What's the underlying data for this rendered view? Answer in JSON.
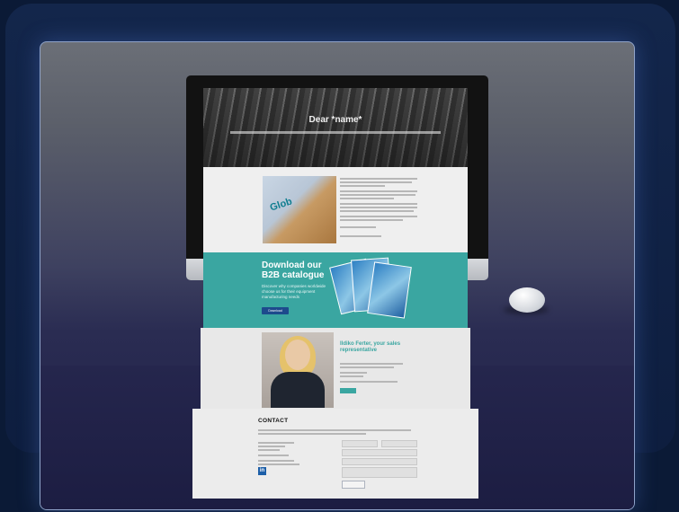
{
  "hero": {
    "title": "Dear *name*"
  },
  "product": {
    "label": "Glob"
  },
  "catalogue": {
    "title": "Download our B2B catalogue",
    "text": "Discover why companies worldwide choose us for their equipment manufacturing needs",
    "button_label": "Download"
  },
  "representative": {
    "title": "Ildiko Ferter, your sales representative"
  },
  "contact": {
    "title": "CONTACT"
  },
  "social": {
    "linkedin_label": "in"
  }
}
